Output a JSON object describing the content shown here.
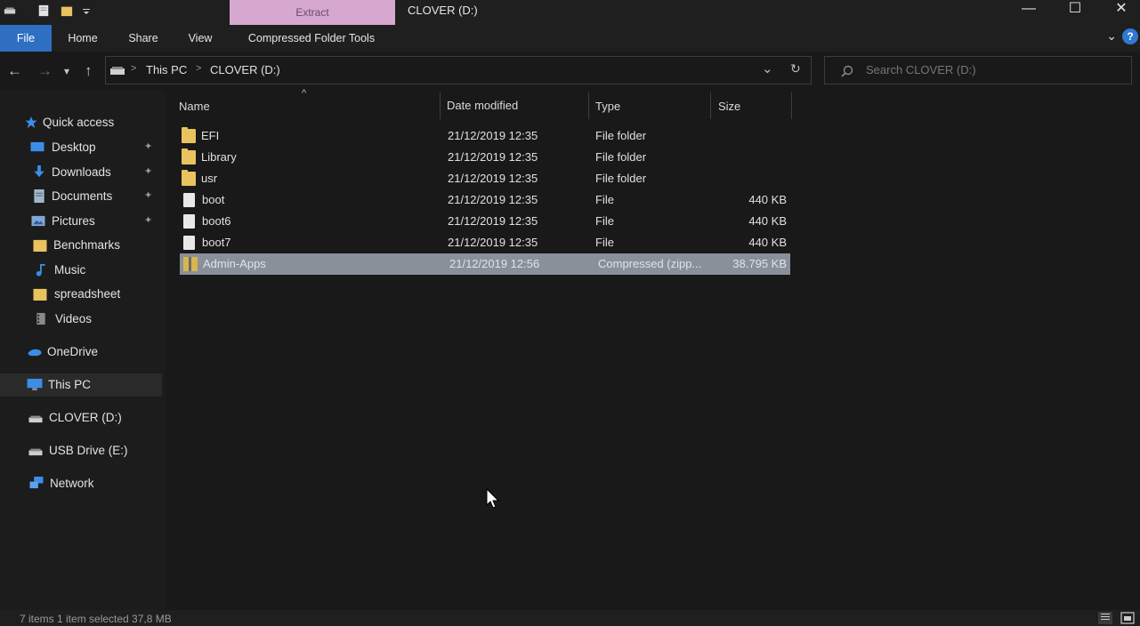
{
  "window": {
    "context_tab": "Extract",
    "title": "CLOVER (D:)",
    "minimize": "—",
    "maximize": "☐",
    "close": "✕"
  },
  "ribbon": {
    "tabs": [
      "File",
      "Home",
      "Share",
      "View",
      "Compressed Folder Tools"
    ],
    "expand_icon": "chevron-down-icon",
    "help_icon": "help-icon",
    "help_glyph": "?"
  },
  "nav": {
    "back": "←",
    "forward": "→",
    "recent": "▾",
    "up": "↑"
  },
  "address": {
    "segments": [
      "This PC",
      "CLOVER (D:)"
    ],
    "separator": ">",
    "dropdown": "⌄",
    "refresh": "↻"
  },
  "search": {
    "placeholder": "Search CLOVER (D:)"
  },
  "sidebar": {
    "items": [
      {
        "label": "Quick access",
        "icon": "star-icon",
        "pinned": false
      },
      {
        "label": "Desktop",
        "icon": "desktop-icon",
        "pinned": true
      },
      {
        "label": "Downloads",
        "icon": "download-icon",
        "pinned": true
      },
      {
        "label": "Documents",
        "icon": "documents-icon",
        "pinned": true
      },
      {
        "label": "Pictures",
        "icon": "pictures-icon",
        "pinned": true
      },
      {
        "label": "Benchmarks",
        "icon": "folder-icon",
        "pinned": false
      },
      {
        "label": "Music",
        "icon": "music-icon",
        "pinned": false
      },
      {
        "label": "spreadsheet",
        "icon": "folder-icon",
        "pinned": false
      },
      {
        "label": "Videos",
        "icon": "videos-icon",
        "pinned": false
      },
      {
        "label": "OneDrive",
        "icon": "cloud-icon",
        "pinned": false
      },
      {
        "label": "This PC",
        "icon": "computer-icon",
        "pinned": false
      },
      {
        "label": "CLOVER (D:)",
        "icon": "drive-icon",
        "pinned": false
      },
      {
        "label": "USB Drive (E:)",
        "icon": "drive-icon",
        "pinned": false
      },
      {
        "label": "Network",
        "icon": "network-icon",
        "pinned": false
      }
    ],
    "pin_glyph": "📌"
  },
  "columns": {
    "name": "Name",
    "date": "Date modified",
    "type": "Type",
    "size": "Size"
  },
  "files": [
    {
      "name": "EFI",
      "date": "21/12/2019 12:35",
      "type": "File folder",
      "size": "",
      "kind": "folder"
    },
    {
      "name": "Library",
      "date": "21/12/2019 12:35",
      "type": "File folder",
      "size": "",
      "kind": "folder"
    },
    {
      "name": "usr",
      "date": "21/12/2019 12:35",
      "type": "File folder",
      "size": "",
      "kind": "folder"
    },
    {
      "name": "boot",
      "date": "21/12/2019 12:35",
      "type": "File",
      "size": "440 KB",
      "kind": "file"
    },
    {
      "name": "boot6",
      "date": "21/12/2019 12:35",
      "type": "File",
      "size": "440 KB",
      "kind": "file"
    },
    {
      "name": "boot7",
      "date": "21/12/2019 12:35",
      "type": "File",
      "size": "440 KB",
      "kind": "file"
    },
    {
      "name": "Admin-Apps",
      "date": "21/12/2019 12:56",
      "type": "Compressed (zipp...",
      "size": "38.795 KB",
      "kind": "zip"
    }
  ],
  "status": {
    "text": "7 items   1 item selected  37,8 MB"
  },
  "colors": {
    "background": "#191919",
    "file_tab": "#2e6fc2",
    "context_tab": "#d6a8d0",
    "selection": "#8a9099",
    "folder": "#e8c35e"
  }
}
